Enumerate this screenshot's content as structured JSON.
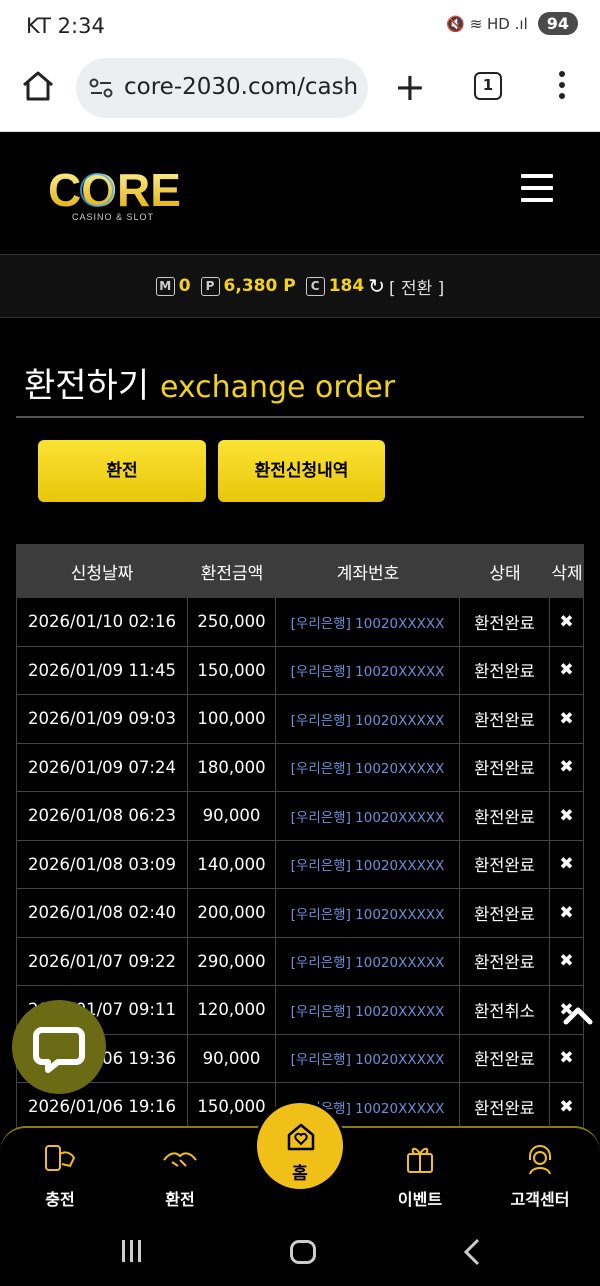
{
  "status_bar": {
    "carrier_time": "KT 2:34",
    "icons_text": "🔇 ≋ HD .ıl",
    "battery": "94"
  },
  "browser": {
    "url": "core-2030.com/cash",
    "tab_count": "1",
    "plus": "+"
  },
  "site": {
    "logo_text": "CORE",
    "logo_sub": "CASINO & SLOT"
  },
  "balance": {
    "m_label": "M",
    "m_value": "0",
    "p_label": "P",
    "p_value": "6,380 P",
    "c_label": "C",
    "c_value": "184",
    "refresh": "↻",
    "convert": "[ 전환 ]"
  },
  "page": {
    "title_ko": "환전하기",
    "title_en": "exchange order",
    "btn_exchange": "환전",
    "btn_history": "환전신청내역"
  },
  "table": {
    "headers": [
      "신청날짜",
      "환전금액",
      "계좌번호",
      "상태",
      "삭제"
    ],
    "rows": [
      {
        "date": "2026/01/10 02:16",
        "amount": "250,000",
        "account": "[우리은행] 10020XXXXX",
        "status": "환전완료",
        "del": "✖"
      },
      {
        "date": "2026/01/09 11:45",
        "amount": "150,000",
        "account": "[우리은행] 10020XXXXX",
        "status": "환전완료",
        "del": "✖"
      },
      {
        "date": "2026/01/09 09:03",
        "amount": "100,000",
        "account": "[우리은행] 10020XXXXX",
        "status": "환전완료",
        "del": "✖"
      },
      {
        "date": "2026/01/09 07:24",
        "amount": "180,000",
        "account": "[우리은행] 10020XXXXX",
        "status": "환전완료",
        "del": "✖"
      },
      {
        "date": "2026/01/08 06:23",
        "amount": "90,000",
        "account": "[우리은행] 10020XXXXX",
        "status": "환전완료",
        "del": "✖"
      },
      {
        "date": "2026/01/08 03:09",
        "amount": "140,000",
        "account": "[우리은행] 10020XXXXX",
        "status": "환전완료",
        "del": "✖"
      },
      {
        "date": "2026/01/08 02:40",
        "amount": "200,000",
        "account": "[우리은행] 10020XXXXX",
        "status": "환전완료",
        "del": "✖"
      },
      {
        "date": "2026/01/07 09:22",
        "amount": "290,000",
        "account": "[우리은행] 10020XXXXX",
        "status": "환전완료",
        "del": "✖"
      },
      {
        "date": "2026/01/07 09:11",
        "amount": "120,000",
        "account": "[우리은행] 10020XXXXX",
        "status": "환전취소",
        "del": "✖"
      },
      {
        "date": "2026/01/06 19:36",
        "amount": "90,000",
        "account": "[우리은행] 10020XXXXX",
        "status": "환전완료",
        "del": "✖"
      },
      {
        "date": "2026/01/06 19:16",
        "amount": "150,000",
        "account": "[우리은행] 10020XXXXX",
        "status": "환전완료",
        "del": "✖"
      }
    ]
  },
  "bottom_nav": {
    "charge": "충전",
    "exchange": "환전",
    "home": "홈",
    "event": "이벤트",
    "support": "고객센터"
  },
  "colors": {
    "accent": "#f2d21a",
    "background": "#000000",
    "link": "#6b8fd8"
  }
}
